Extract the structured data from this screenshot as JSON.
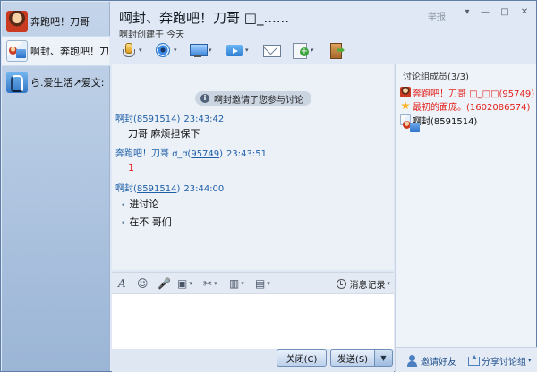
{
  "conversations": [
    {
      "label": "奔跑吧！刀哥",
      "avatar": "fire-avatar-icon"
    },
    {
      "label": "啊封、奔跑吧！刀",
      "avatar": "group-avatar-icon"
    },
    {
      "label": "ら.爱生活↗爱文:",
      "avatar": "contact-avatar-icon"
    }
  ],
  "header": {
    "title": "啊封、奔跑吧！刀哥 □_......",
    "subtitle": "啊封创建于 今天",
    "report": "举报"
  },
  "window_controls": {
    "menu": "▾",
    "minimize": "—",
    "maximize": "□",
    "close": "✕"
  },
  "toolbar": {
    "items": [
      "mic-icon",
      "camera-icon",
      "screen-share-icon",
      "file-transfer-icon",
      "mail-icon",
      "note-icon",
      "exit-icon"
    ],
    "dropdown": "▾"
  },
  "chat": {
    "notice": "啊封邀请了您参与讨论",
    "info_glyph": "i",
    "messages": [
      {
        "name": "啊封(",
        "id": "8591514",
        "close": ")",
        "time": "23:43:42",
        "text": "刀哥 麻烦担保下"
      },
      {
        "name": "奔跑吧！刀哥  ơ_ơ(",
        "id": "95749",
        "close": ")",
        "time": "23:43:51",
        "text": "1"
      },
      {
        "name": "啊封(",
        "id": "8591514",
        "close": ")",
        "time": "23:44:00",
        "lines": [
          "进讨论",
          "在不 哥们"
        ]
      }
    ]
  },
  "input_toolbar": {
    "font": "A",
    "emoji": "☺",
    "voice": "🎤",
    "image": "▣",
    "scissors": "✂",
    "chart": "▥",
    "more": "▤",
    "history": "消息记录",
    "dropdown": "▾"
  },
  "buttons": {
    "close": "关闭(C)",
    "send": "发送(S)",
    "send_dropdown": "▼"
  },
  "members": {
    "title": "讨论组成员(3/3)",
    "list": [
      {
        "name": "奔跑吧！刀哥 □_□□(95749)",
        "color": "#e3201a"
      },
      {
        "name": "最初的面庞。(1602086574)",
        "color": "#e3201a"
      },
      {
        "name": "啊封(8591514)",
        "color": "#111111"
      }
    ],
    "invite": "邀请好友",
    "share": "分享讨论组",
    "share_dropdown": "▾"
  }
}
